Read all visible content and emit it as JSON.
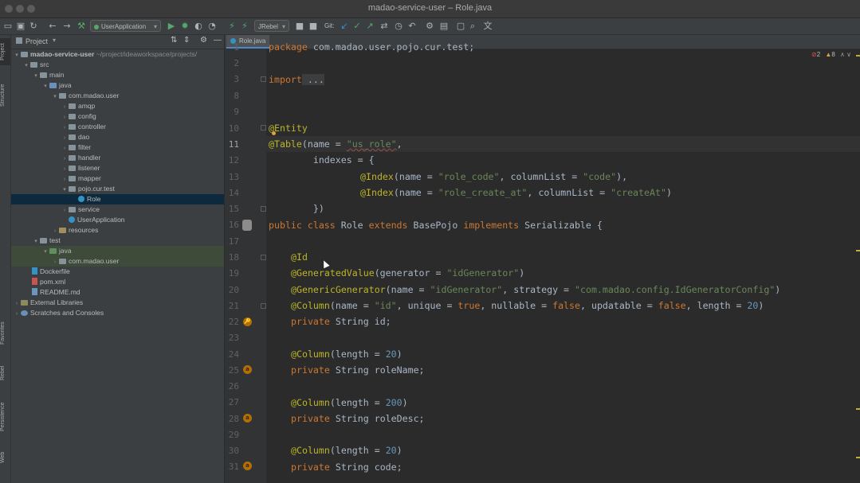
{
  "window": {
    "title": "madao-service-user – Role.java"
  },
  "toolbar": {
    "run_config": "UserApplication",
    "jrebel": "JRebel",
    "git": "Git:"
  },
  "left_stripe": {
    "project": "Project",
    "structure": "Structure",
    "favorites": "Favorites",
    "rebel": "Rebel",
    "persistence": "Persistence",
    "web": "Web"
  },
  "project_panel": {
    "header": "Project",
    "tree": [
      {
        "label": "madao-service-user",
        "path": "~/project/ideaworkspace/projects/"
      },
      {
        "label": "src"
      },
      {
        "label": "main"
      },
      {
        "label": "java"
      },
      {
        "label": "com.madao.user"
      },
      {
        "label": "amqp"
      },
      {
        "label": "config"
      },
      {
        "label": "controller"
      },
      {
        "label": "dao"
      },
      {
        "label": "filter"
      },
      {
        "label": "handler"
      },
      {
        "label": "listener"
      },
      {
        "label": "mapper"
      },
      {
        "label": "pojo.cur.test"
      },
      {
        "label": "Role"
      },
      {
        "label": "service"
      },
      {
        "label": "UserApplication"
      },
      {
        "label": "resources"
      },
      {
        "label": "test"
      },
      {
        "label": "java"
      },
      {
        "label": "com.madao.user"
      },
      {
        "label": "Dockerfile"
      },
      {
        "label": "pom.xml"
      },
      {
        "label": "README.md"
      },
      {
        "label": "External Libraries"
      },
      {
        "label": "Scratches and Consoles"
      }
    ]
  },
  "editor": {
    "tab": "Role.java",
    "problems": {
      "errors": "2",
      "warnings": "8"
    },
    "line_numbers": [
      "1",
      "2",
      "3",
      "8",
      "9",
      "10",
      "11",
      "12",
      "13",
      "14",
      "15",
      "16",
      "17",
      "18",
      "19",
      "20",
      "21",
      "22",
      "23",
      "24",
      "25",
      "26",
      "27",
      "28",
      "29",
      "30",
      "31"
    ],
    "code": {
      "l1": {
        "kw": "package",
        "rest": " com.madao.user.pojo.cur.test;"
      },
      "l3": {
        "kw": "import",
        "rest": " ..."
      },
      "l10": {
        "an": "@Entity"
      },
      "l11": {
        "an": "@Table",
        "a": "(name = ",
        "s1": "\"us_role\"",
        "b": ","
      },
      "l12": {
        "text": "        indexes = {"
      },
      "l13": {
        "an": "@Index",
        "a": "(name = ",
        "s1": "\"role_code\"",
        "b": ", columnList = ",
        "s2": "\"code\"",
        "c": "),"
      },
      "l14": {
        "an": "@Index",
        "a": "(name = ",
        "s1": "\"role_create_at\"",
        "b": ", columnList = ",
        "s2": "\"createAt\"",
        "c": ")"
      },
      "l15": {
        "text": "        })"
      },
      "l16": {
        "k1": "public class",
        "a": " Role ",
        "k2": "extends",
        "b": " BasePojo ",
        "k3": "implements",
        "c": " Serializable {"
      },
      "l18": {
        "an": "@Id"
      },
      "l19": {
        "an": "@GeneratedValue",
        "a": "(generator = ",
        "s1": "\"idGenerator\"",
        "b": ")"
      },
      "l20": {
        "an": "@GenericGenerator",
        "a": "(name = ",
        "s1": "\"idGenerator\"",
        "b": ", strategy = ",
        "s2": "\"com.madao.config.IdGeneratorConfig\"",
        "c": ")"
      },
      "l21": {
        "an": "@Column",
        "a": "(name = ",
        "s1": "\"id\"",
        "b": ", unique = ",
        "k1": "true",
        "c": ", nullable = ",
        "k2": "false",
        "d": ", updatable = ",
        "k3": "false",
        "e": ", length = ",
        "n": "20",
        "f": ")"
      },
      "l22": {
        "kw": "private",
        "rest": " String id;"
      },
      "l24": {
        "an": "@Column",
        "a": "(length = ",
        "n": "20",
        "b": ")"
      },
      "l25": {
        "kw": "private",
        "rest": " String roleName;"
      },
      "l27": {
        "an": "@Column",
        "a": "(length = ",
        "n": "200",
        "b": ")"
      },
      "l28": {
        "kw": "private",
        "rest": " String roleDesc;"
      },
      "l30": {
        "an": "@Column",
        "a": "(length = ",
        "n": "20",
        "b": ")"
      },
      "l31": {
        "kw": "private",
        "rest": " String code;"
      }
    },
    "gutter_badge": "a"
  },
  "colors": {
    "keyword": "#cc7832",
    "annotation": "#bbb529",
    "string": "#6a8759",
    "number": "#6897bb",
    "text": "#a9b7c6"
  }
}
